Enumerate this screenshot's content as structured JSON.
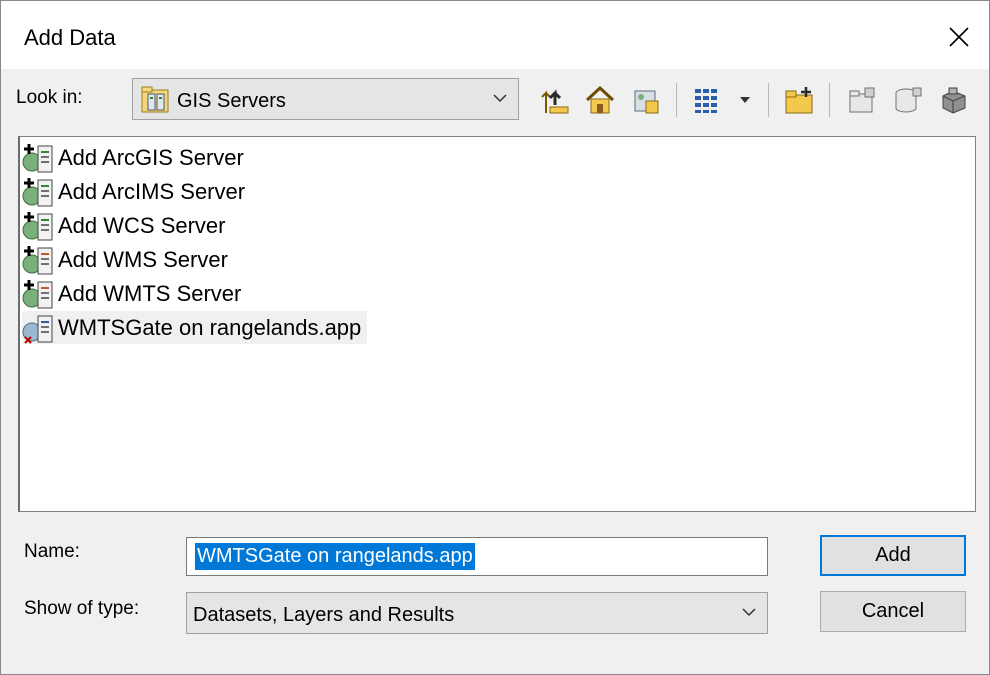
{
  "window": {
    "title": "Add Data",
    "close_icon": "close-icon"
  },
  "lookin": {
    "label": "Look in:",
    "value": "GIS Servers",
    "icon": "gis-servers-icon"
  },
  "toolbar": {
    "icons": [
      "up-one-level-icon",
      "home-icon",
      "connect-to-folder-icon",
      "view-list-icon",
      "dropdown-arrow-icon",
      "new-folder-icon",
      "catalog-icon",
      "new-database-icon",
      "toolbox-icon"
    ]
  },
  "items": [
    {
      "label": "Add ArcGIS Server",
      "icon": "add-server-icon",
      "selected": false
    },
    {
      "label": "Add ArcIMS Server",
      "icon": "add-server-icon",
      "selected": false
    },
    {
      "label": "Add WCS Server",
      "icon": "add-server-icon",
      "selected": false
    },
    {
      "label": "Add WMS Server",
      "icon": "add-server-icon",
      "selected": false
    },
    {
      "label": "Add WMTS Server",
      "icon": "add-server-icon",
      "selected": false
    },
    {
      "label": "WMTSGate on rangelands.app",
      "icon": "wmts-server-icon",
      "selected": true
    }
  ],
  "name_field": {
    "label": "Name:",
    "value": "WMTSGate on rangelands.app"
  },
  "type_field": {
    "label": "Show of type:",
    "value": "Datasets, Layers and Results"
  },
  "buttons": {
    "add": "Add",
    "cancel": "Cancel"
  },
  "colors": {
    "accent": "#0078d7",
    "background": "#f0f0f0"
  }
}
